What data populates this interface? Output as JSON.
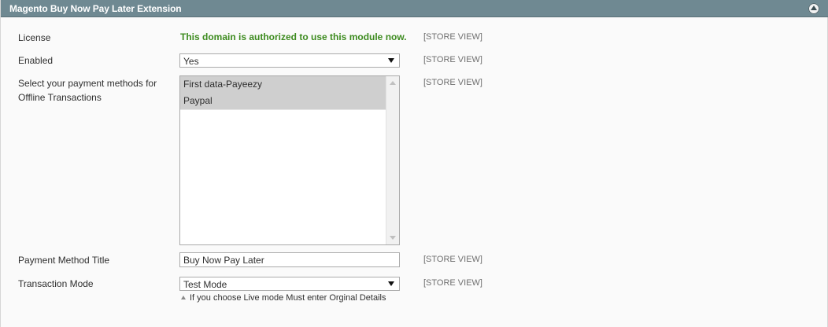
{
  "header": {
    "title": "Magento Buy Now Pay Later Extension",
    "collapse_icon": "collapse-up-icon"
  },
  "scope_label": "[STORE VIEW]",
  "fields": {
    "license": {
      "label": "License",
      "message": "This domain is authorized to use this module now.",
      "message_color": "#3d8b1f"
    },
    "enabled": {
      "label": "Enabled",
      "value": "Yes"
    },
    "payment_methods": {
      "label_line1": "Select your payment methods for",
      "label_line2": "Offline Transactions",
      "options": [
        "First data-Payeezy",
        "Paypal"
      ]
    },
    "payment_method_title": {
      "label": "Payment Method Title",
      "value": "Buy Now Pay Later"
    },
    "transaction_mode": {
      "label": "Transaction Mode",
      "value": "Test Mode",
      "note": "If you choose Live mode Must enter Orginal Details"
    }
  },
  "colors": {
    "header_bg": "#6f8992",
    "section_bg": "#fafafa",
    "selected_option_bg": "#cfcfcf"
  }
}
